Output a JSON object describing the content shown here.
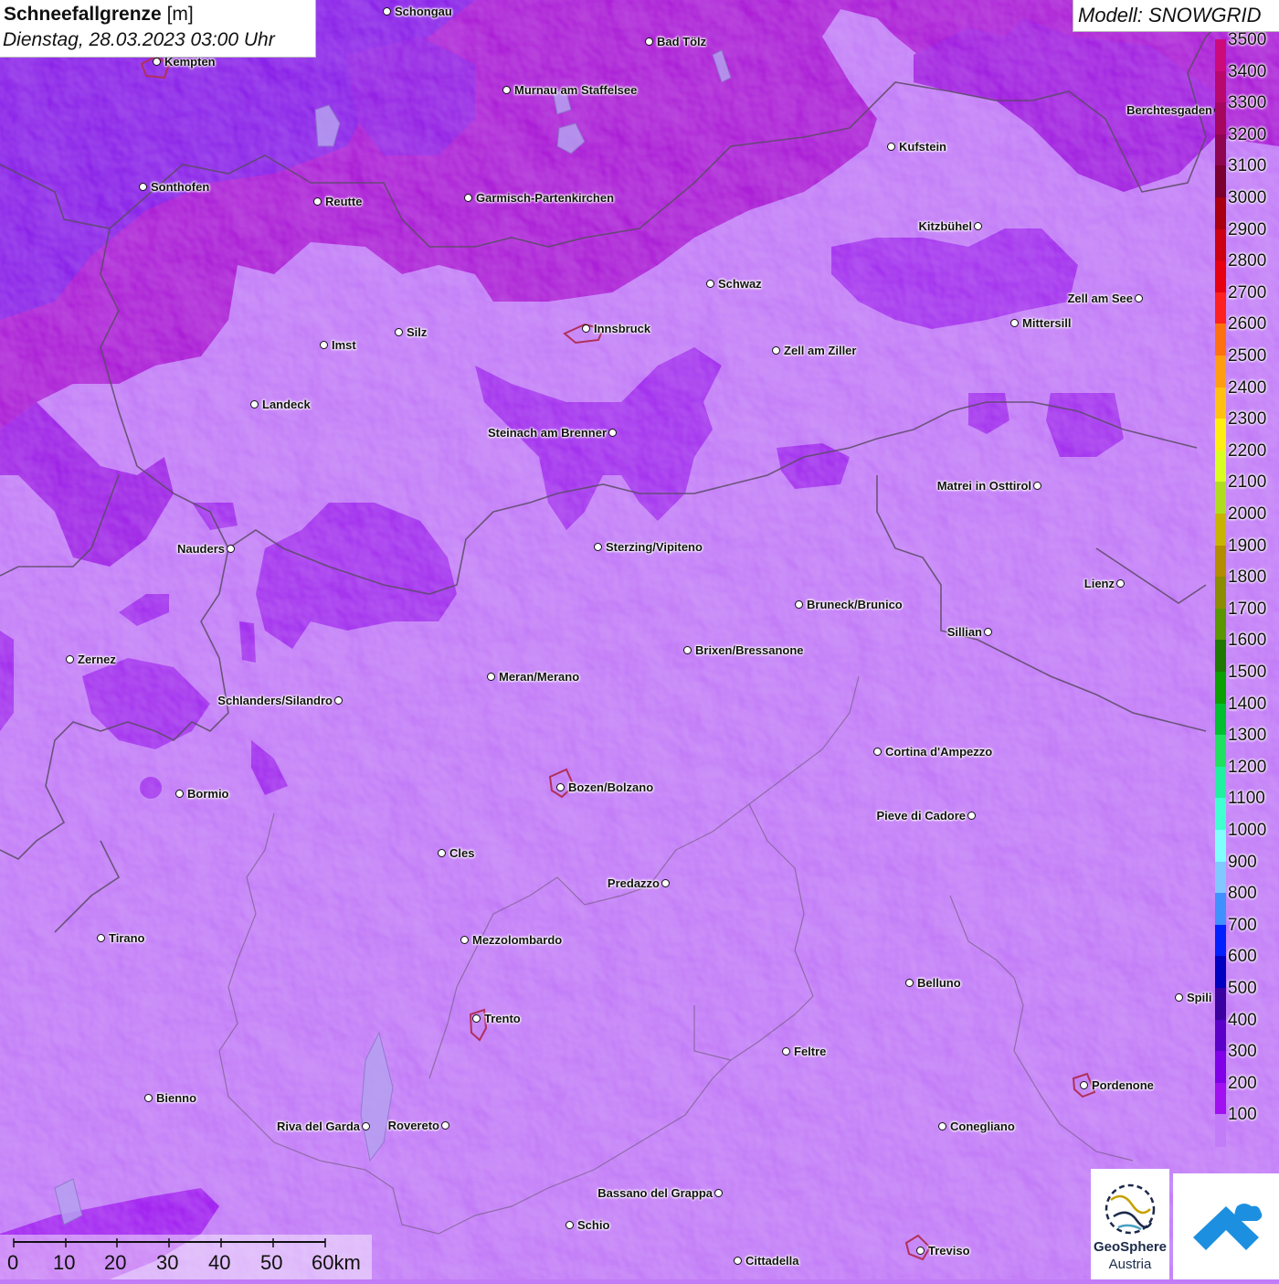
{
  "header": {
    "title_bold": "Schneefallgrenze",
    "title_unit": "[m]",
    "datetime": "Dienstag, 28.03.2023 03:00 Uhr"
  },
  "model": {
    "label": "Modell: SNOWGRID"
  },
  "legend": {
    "unit": "m",
    "ticks": [
      "3500",
      "3400",
      "3300",
      "3200",
      "3100",
      "3000",
      "2900",
      "2800",
      "2700",
      "2600",
      "2500",
      "2400",
      "2300",
      "2200",
      "2100",
      "2000",
      "1900",
      "1800",
      "1700",
      "1600",
      "1500",
      "1400",
      "1300",
      "1200",
      "1100",
      "1000",
      "900",
      "800",
      "700",
      "600",
      "500",
      "400",
      "300",
      "200",
      "100"
    ],
    "colors": [
      "#cc0a7a",
      "#b9086c",
      "#a5075e",
      "#8e0650",
      "#7a0030",
      "#a80010",
      "#cc0010",
      "#e60010",
      "#ff2020",
      "#ff7010",
      "#ff9c10",
      "#ffc010",
      "#ffee10",
      "#d8ff20",
      "#b0dc20",
      "#c8b400",
      "#b48c00",
      "#8c8c00",
      "#5a9600",
      "#1e7800",
      "#0aa000",
      "#00c030",
      "#20e060",
      "#20f0a0",
      "#40ffd0",
      "#80ffff",
      "#80c8ff",
      "#4090ff",
      "#0020ff",
      "#0000c0",
      "#3a00a0",
      "#5a00c8",
      "#8000e8",
      "#a010f0",
      "#c27cf7"
    ]
  },
  "cities": [
    {
      "name": "Schongau",
      "label_side": "right"
    },
    {
      "name": "Bad Tölz",
      "label_side": "right"
    },
    {
      "name": "Kempten",
      "label_side": "right"
    },
    {
      "name": "Murnau am Staffelsee",
      "label_side": "right"
    },
    {
      "name": "Kufstein",
      "label_side": "right"
    },
    {
      "name": "Berchtesgaden",
      "label_side": "left"
    },
    {
      "name": "Sonthofen",
      "label_side": "right"
    },
    {
      "name": "Reutte",
      "label_side": "right"
    },
    {
      "name": "Garmisch-Partenkirchen",
      "label_side": "right"
    },
    {
      "name": "Kitzbühel",
      "label_side": "left"
    },
    {
      "name": "Schwaz",
      "label_side": "right"
    },
    {
      "name": "Zell am See",
      "label_side": "left"
    },
    {
      "name": "Innsbruck",
      "label_side": "right"
    },
    {
      "name": "Mittersill",
      "label_side": "right"
    },
    {
      "name": "Imst",
      "label_side": "right"
    },
    {
      "name": "Silz",
      "label_side": "right"
    },
    {
      "name": "Zell am Ziller",
      "label_side": "right"
    },
    {
      "name": "Landeck",
      "label_side": "right"
    },
    {
      "name": "Steinach am Brenner",
      "label_side": "left"
    },
    {
      "name": "Matrei in Osttirol",
      "label_side": "left"
    },
    {
      "name": "Nauders",
      "label_side": "left"
    },
    {
      "name": "Sterzing/Vipiteno",
      "label_side": "right"
    },
    {
      "name": "Lienz",
      "label_side": "left"
    },
    {
      "name": "Bruneck/Brunico",
      "label_side": "right"
    },
    {
      "name": "Sillian",
      "label_side": "left"
    },
    {
      "name": "Zernez",
      "label_side": "right"
    },
    {
      "name": "Brixen/Bressanone",
      "label_side": "right"
    },
    {
      "name": "Meran/Merano",
      "label_side": "right"
    },
    {
      "name": "Schlanders/Silandro",
      "label_side": "left"
    },
    {
      "name": "Cortina d'Ampezzo",
      "label_side": "right"
    },
    {
      "name": "Bormio",
      "label_side": "right"
    },
    {
      "name": "Bozen/Bolzano",
      "label_side": "right"
    },
    {
      "name": "Pieve di Cadore",
      "label_side": "left"
    },
    {
      "name": "Cles",
      "label_side": "right"
    },
    {
      "name": "Predazzo",
      "label_side": "left"
    },
    {
      "name": "Tirano",
      "label_side": "right"
    },
    {
      "name": "Mezzolombardo",
      "label_side": "right"
    },
    {
      "name": "Belluno",
      "label_side": "right"
    },
    {
      "name": "Spili",
      "label_side": "right"
    },
    {
      "name": "Trento",
      "label_side": "right"
    },
    {
      "name": "Feltre",
      "label_side": "right"
    },
    {
      "name": "Pordenone",
      "label_side": "right"
    },
    {
      "name": "Bienno",
      "label_side": "right"
    },
    {
      "name": "Riva del Garda",
      "label_side": "left"
    },
    {
      "name": "Rovereto",
      "label_side": "left"
    },
    {
      "name": "Conegliano",
      "label_side": "right"
    },
    {
      "name": "Bassano del Grappa",
      "label_side": "left"
    },
    {
      "name": "Schio",
      "label_side": "right"
    },
    {
      "name": "Treviso",
      "label_side": "right"
    },
    {
      "name": "Cittadella",
      "label_side": "right"
    }
  ],
  "scale_bar": {
    "labels": [
      "0",
      "10",
      "20",
      "30",
      "40",
      "50",
      "60km"
    ]
  },
  "logos": {
    "geosphere_line1": "GeoSphere",
    "geosphere_line2": "Austria"
  },
  "colors": {
    "base": "#c27cf7",
    "mid": "#a225f0",
    "dark": "#8a17e0",
    "magenta": "#ae1ccf",
    "border": "#555555",
    "city_outline": "#b0305a"
  }
}
